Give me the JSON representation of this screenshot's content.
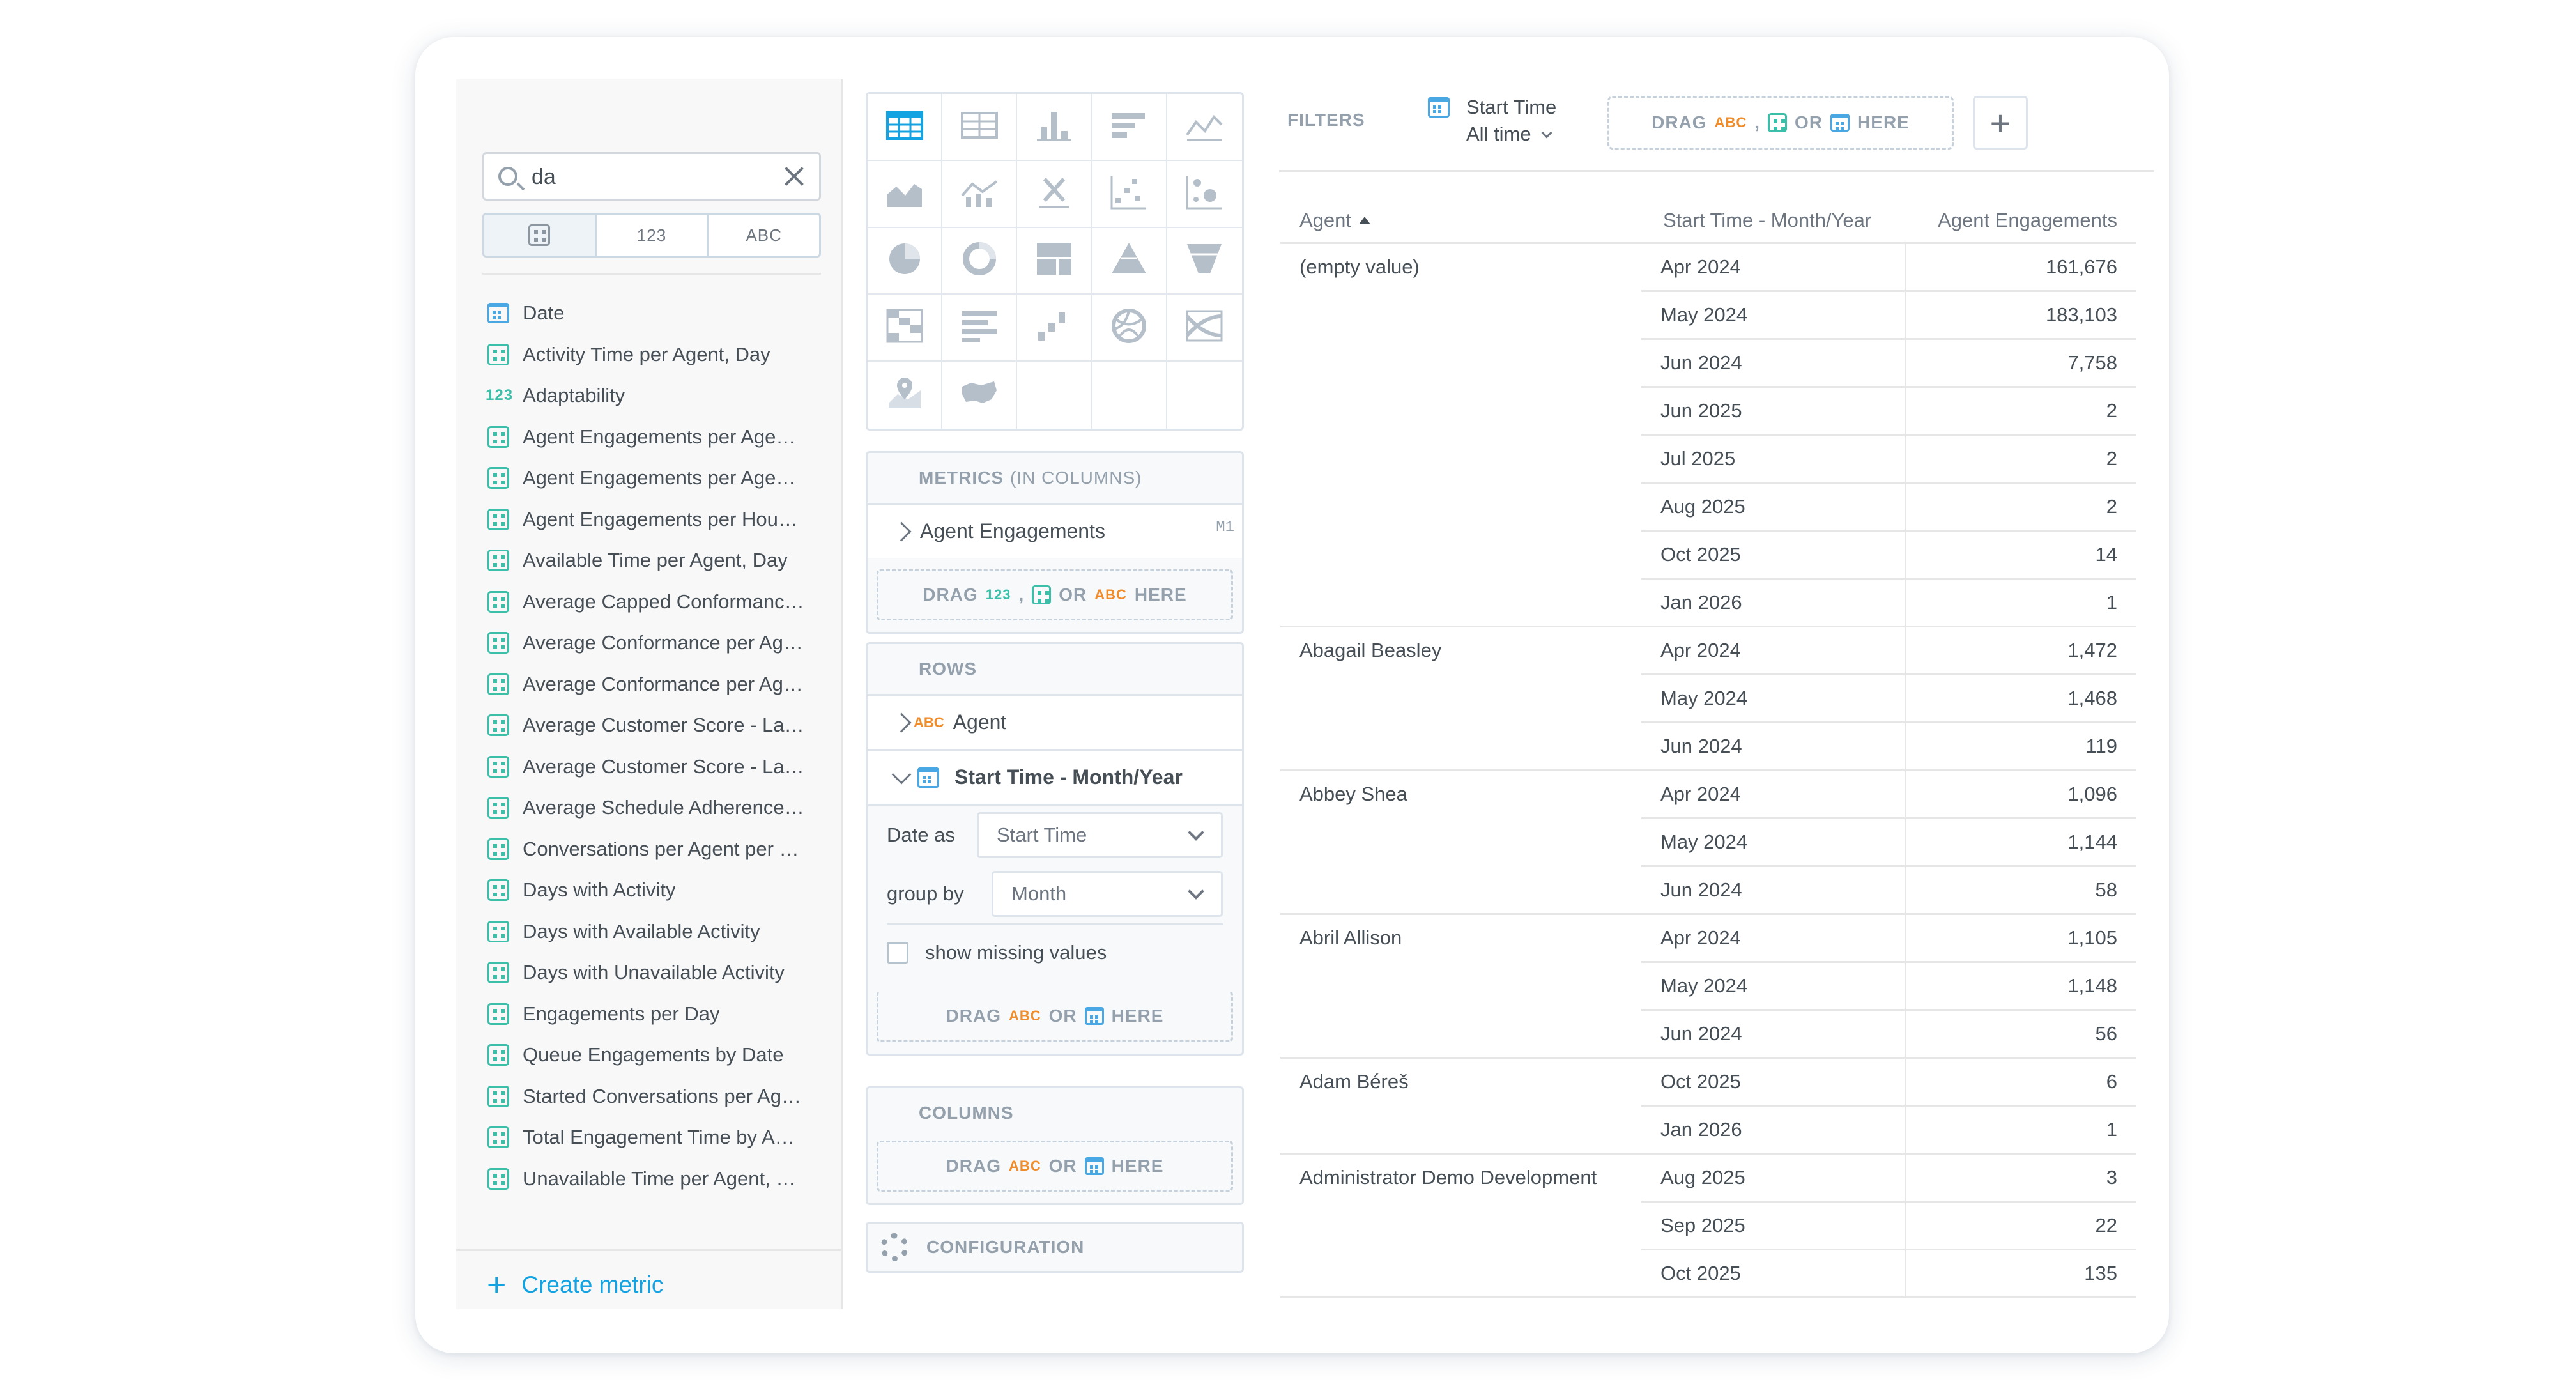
{
  "catalog": {
    "search_value": "da",
    "type_filters": [
      "",
      "123",
      "ABC"
    ],
    "items": [
      {
        "type": "date",
        "label": "Date"
      },
      {
        "type": "metric",
        "label": "Activity Time per Agent, Day"
      },
      {
        "type": "number",
        "label": "Adaptability"
      },
      {
        "type": "metric",
        "label": "Agent Engagements per Age…"
      },
      {
        "type": "metric",
        "label": "Agent Engagements per Age…"
      },
      {
        "type": "metric",
        "label": "Agent Engagements per Hou…"
      },
      {
        "type": "metric",
        "label": "Available Time per Agent, Day"
      },
      {
        "type": "metric",
        "label": "Average Capped Conformanc…"
      },
      {
        "type": "metric",
        "label": "Average Conformance per Ag…"
      },
      {
        "type": "metric",
        "label": "Average Conformance per Ag…"
      },
      {
        "type": "metric",
        "label": "Average Customer Score - La…"
      },
      {
        "type": "metric",
        "label": "Average Customer Score - La…"
      },
      {
        "type": "metric",
        "label": "Average Schedule Adherence…"
      },
      {
        "type": "metric",
        "label": "Conversations per Agent per …"
      },
      {
        "type": "metric",
        "label": "Days with Activity"
      },
      {
        "type": "metric",
        "label": "Days with Available Activity"
      },
      {
        "type": "metric",
        "label": "Days with Unavailable Activity"
      },
      {
        "type": "metric",
        "label": "Engagements per Day"
      },
      {
        "type": "metric",
        "label": "Queue Engagements by Date"
      },
      {
        "type": "metric",
        "label": "Started Conversations per Ag…"
      },
      {
        "type": "metric",
        "label": "Total Engagement Time by A…"
      },
      {
        "type": "metric",
        "label": "Unavailable Time per Agent, …"
      }
    ],
    "create_metric_label": "Create metric"
  },
  "buckets": {
    "metrics": {
      "title": "METRICS",
      "subtitle": "(IN COLUMNS)",
      "item_label": "Agent Engagements",
      "item_tag": "M1",
      "drop_drag": "DRAG",
      "drop_num": "123",
      "drop_comma": ",",
      "drop_or": "OR",
      "drop_attr": "ABC",
      "drop_here": "HERE"
    },
    "rows": {
      "title": "ROWS",
      "item1_type": "ABC",
      "item1_label": "Agent",
      "item2_label": "Start Time - Month/Year",
      "date_as_label": "Date as",
      "date_as_value": "Start Time",
      "group_by_label": "group by",
      "group_by_value": "Month",
      "show_missing_label": "show missing values",
      "drop_drag": "DRAG",
      "drop_attr": "ABC",
      "drop_or": "OR",
      "drop_here": "HERE"
    },
    "columns": {
      "title": "COLUMNS",
      "drop_drag": "DRAG",
      "drop_attr": "ABC",
      "drop_or": "OR",
      "drop_here": "HERE"
    },
    "configuration_label": "CONFIGURATION"
  },
  "filters": {
    "label": "FILTERS",
    "chip_title": "Start Time",
    "chip_value": "All time",
    "drop_drag": "DRAG",
    "drop_attr": "ABC",
    "drop_comma": ",",
    "drop_or": "OR",
    "drop_here": "HERE",
    "add_label": "+"
  },
  "table": {
    "headers": [
      "Agent",
      "Start Time - Month/Year",
      "Agent Engagements"
    ],
    "groups": [
      {
        "agent": "(empty value)",
        "rows": [
          [
            "Apr 2024",
            "161,676"
          ],
          [
            "May 2024",
            "183,103"
          ],
          [
            "Jun 2024",
            "7,758"
          ],
          [
            "Jun 2025",
            "2"
          ],
          [
            "Jul 2025",
            "2"
          ],
          [
            "Aug 2025",
            "2"
          ],
          [
            "Oct 2025",
            "14"
          ],
          [
            "Jan 2026",
            "1"
          ]
        ]
      },
      {
        "agent": "Abagail Beasley",
        "rows": [
          [
            "Apr 2024",
            "1,472"
          ],
          [
            "May 2024",
            "1,468"
          ],
          [
            "Jun 2024",
            "119"
          ]
        ]
      },
      {
        "agent": "Abbey Shea",
        "rows": [
          [
            "Apr 2024",
            "1,096"
          ],
          [
            "May 2024",
            "1,144"
          ],
          [
            "Jun 2024",
            "58"
          ]
        ]
      },
      {
        "agent": "Abril Allison",
        "rows": [
          [
            "Apr 2024",
            "1,105"
          ],
          [
            "May 2024",
            "1,148"
          ],
          [
            "Jun 2024",
            "56"
          ]
        ]
      },
      {
        "agent": "Adam Béreš",
        "rows": [
          [
            "Oct 2025",
            "6"
          ],
          [
            "Jan 2026",
            "1"
          ]
        ]
      },
      {
        "agent": "Administrator Demo Development",
        "rows": [
          [
            "Aug 2025",
            "3"
          ],
          [
            "Sep 2025",
            "22"
          ],
          [
            "Oct 2025",
            "135"
          ]
        ]
      }
    ]
  },
  "colors": {
    "accent_blue": "#14a3e2",
    "metric_green": "#3bbfa8",
    "attribute_orange": "#f08c2a",
    "date_blue": "#49a7e3"
  },
  "visualizations": [
    "table-icon",
    "headline-icon",
    "column-chart-icon",
    "bar-chart-icon",
    "line-chart-icon",
    "area-chart-icon",
    "combo-chart-icon",
    "xirr-icon",
    "scatter-plot-icon",
    "bubble-chart-icon",
    "pie-chart-icon",
    "donut-chart-icon",
    "treemap-icon",
    "pyramid-chart-icon",
    "funnel-chart-icon",
    "heatmap-icon",
    "bullet-chart-icon",
    "waterfall-chart-icon",
    "dependency-wheel-icon",
    "sankey-chart-icon",
    "geo-pushpin-icon",
    "geo-area-map-icon"
  ]
}
